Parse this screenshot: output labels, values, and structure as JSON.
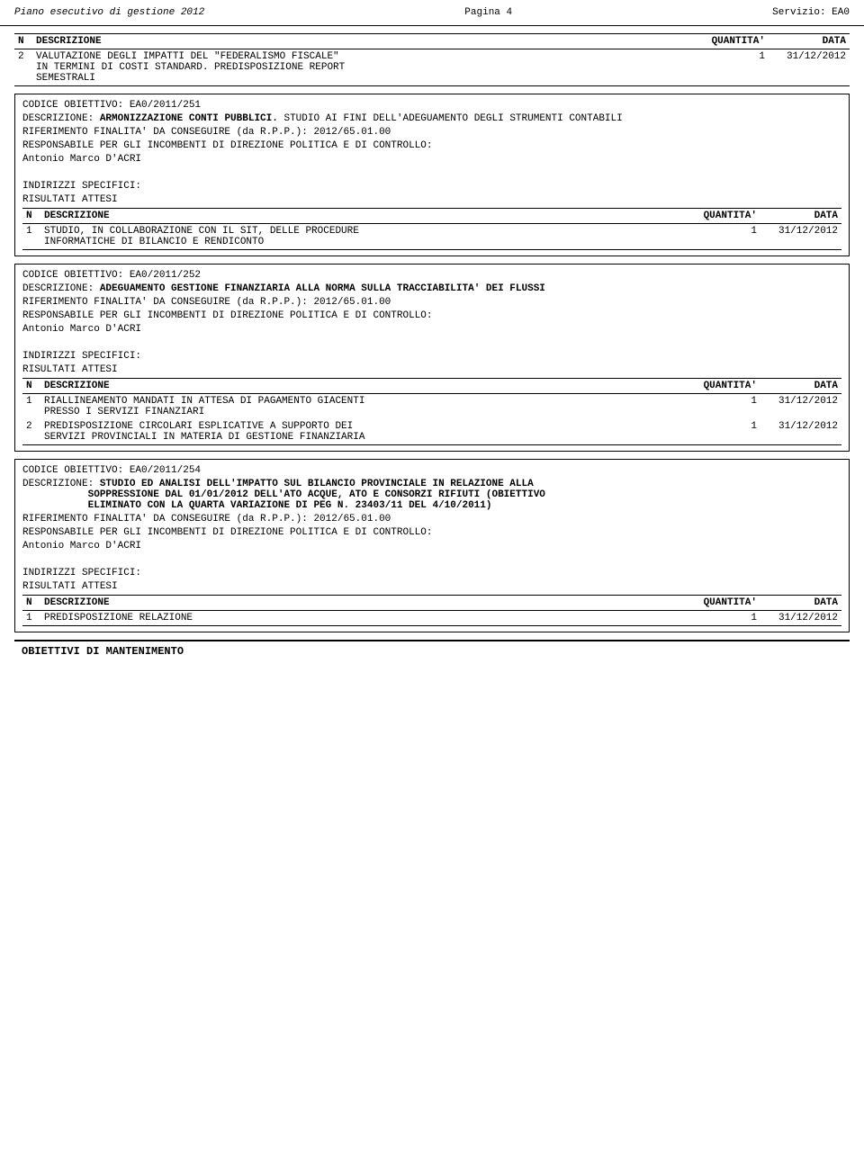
{
  "header": {
    "left": "Piano esecutivo di gestione 2012",
    "center": "Pagina 4",
    "right": "Servizio: EA0"
  },
  "top_table": {
    "columns": [
      "N",
      "DESCRIZIONE",
      "QUANTITA'",
      "DATA"
    ],
    "rows": [
      {
        "n": "2",
        "descrizione_line1": "VALUTAZIONE DEGLI IMPATTI DEL \"FEDERALISMO FISCALE\"",
        "descrizione_line2": "IN TERMINI DI COSTI STANDARD. PREDISPOSIZIONE REPORT",
        "descrizione_line3": "SEMESTRALI",
        "quantita": "1",
        "data": "31/12/2012"
      }
    ]
  },
  "sections": [
    {
      "id": "EA0/2011/251",
      "codice_label": "CODICE OBIETTIVO: EA0/2011/251",
      "descrizione_label": "DESCRIZIONE:",
      "descrizione_bold": "ARMONIZZAZIONE CONTI PUBBLICI.",
      "descrizione_rest": " STUDIO AI FINI DELL'ADEGUAMENTO DEGLI STRUMENTI CONTABILI",
      "riferimento_label": "RIFERIMENTO FINALITA' DA CONSEGUIRE (da R.P.P.):",
      "riferimento_value": "2012/65.01.00",
      "responsabile_label": "RESPONSABILE PER GLI INCOMBENTI DI DIREZIONE POLITICA E DI CONTROLLO:",
      "responsabile_name": "Antonio Marco D'ACRI",
      "indirizzi": "INDIRIZZI SPECIFICI:",
      "risultati": "RISULTATI ATTESI",
      "table_columns": [
        "N",
        "DESCRIZIONE",
        "QUANTITA'",
        "DATA"
      ],
      "table_rows": [
        {
          "n": "1",
          "descrizione_line1": "STUDIO, IN COLLABORAZIONE CON IL SIT, DELLE PROCEDURE",
          "descrizione_line2": "INFORMATICHE DI BILANCIO E RENDICONTO",
          "quantita": "1",
          "data": "31/12/2012"
        }
      ]
    },
    {
      "id": "EA0/2011/252",
      "codice_label": "CODICE OBIETTIVO: EA0/2011/252",
      "descrizione_label": "DESCRIZIONE:",
      "descrizione_bold": "ADEGUAMENTO GESTIONE FINANZIARIA ALLA NORMA SULLA TRACCIABILITA' DEI FLUSSI",
      "descrizione_rest": "",
      "riferimento_label": "RIFERIMENTO FINALITA' DA CONSEGUIRE (da R.P.P.):",
      "riferimento_value": "2012/65.01.00",
      "responsabile_label": "RESPONSABILE PER GLI INCOMBENTI DI DIREZIONE POLITICA E DI CONTROLLO:",
      "responsabile_name": "Antonio Marco D'ACRI",
      "indirizzi": "INDIRIZZI SPECIFICI:",
      "risultati": "RISULTATI ATTESI",
      "table_columns": [
        "N",
        "DESCRIZIONE",
        "QUANTITA'",
        "DATA"
      ],
      "table_rows": [
        {
          "n": "1",
          "descrizione_line1": "RIALLINEAMENTO MANDATI IN ATTESA DI PAGAMENTO GIACENTI",
          "descrizione_line2": "PRESSO I SERVIZI FINANZIARI",
          "quantita": "1",
          "data": "31/12/2012"
        },
        {
          "n": "2",
          "descrizione_line1": "PREDISPOSIZIONE CIRCOLARI ESPLICATIVE A SUPPORTO DEI",
          "descrizione_line2": "SERVIZI PROVINCIALI IN MATERIA DI GESTIONE FINANZIARIA",
          "quantita": "1",
          "data": "31/12/2012"
        }
      ]
    },
    {
      "id": "EA0/2011/254",
      "codice_label": "CODICE OBIETTIVO: EA0/2011/254",
      "descrizione_label": "DESCRIZIONE:",
      "descrizione_bold": "STUDIO ED ANALISI DELL'IMPATTO SUL BILANCIO PROVINCIALE IN RELAZIONE ALLA SOPPRESSIONE DAL 01/01/2012 DELL'ATO ACQUE, ATO E CONSORZI RIFIUTI (OBIETTIVO ELIMINATO CON LA QUARTA VARIAZIONE DI PEG N. 23403/11 DEL 4/10/2011)",
      "descrizione_rest": "",
      "riferimento_label": "RIFERIMENTO FINALITA' DA CONSEGUIRE (da R.P.P.):",
      "riferimento_value": "2012/65.01.00",
      "responsabile_label": "RESPONSABILE PER GLI INCOMBENTI DI DIREZIONE POLITICA E DI CONTROLLO:",
      "responsabile_name": "Antonio Marco D'ACRI",
      "indirizzi": "INDIRIZZI SPECIFICI:",
      "risultati": "RISULTATI ATTESI",
      "table_columns": [
        "N",
        "DESCRIZIONE",
        "QUANTITA'",
        "DATA"
      ],
      "table_rows": [
        {
          "n": "1",
          "descrizione_line1": "PREDISPOSIZIONE RELAZIONE",
          "descrizione_line2": "",
          "quantita": "1",
          "data": "31/12/2012"
        }
      ]
    }
  ],
  "footer": {
    "label": "OBIETTIVI DI MANTENIMENTO"
  }
}
